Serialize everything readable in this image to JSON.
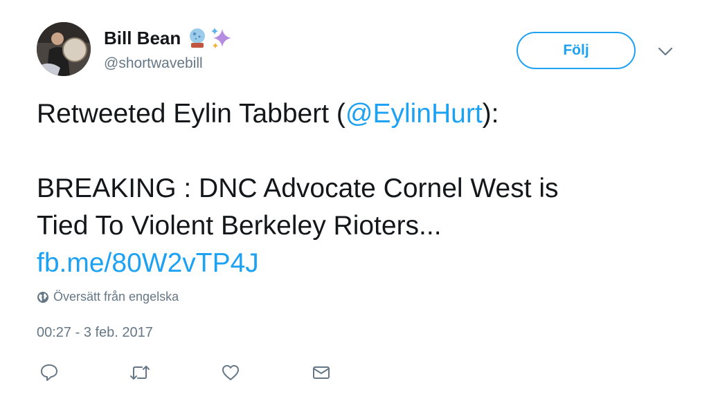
{
  "user": {
    "name": "Bill Bean",
    "handle": "@shortwavebill",
    "name_emojis": [
      "crystal-ball-icon",
      "sparkles-icon"
    ]
  },
  "follow_button": {
    "label": "Följ"
  },
  "tweet": {
    "retweet_prefix": "Retweeted Eylin Tabbert (",
    "retweet_handle": "@EylinHurt",
    "retweet_suffix": "):",
    "body_line1": "BREAKING : DNC Advocate Cornel West is",
    "body_line2": "Tied To Violent Berkeley Rioters...",
    "link": "fb.me/80W2vTP4J"
  },
  "translate": {
    "label": "Översätt från engelska",
    "icon": "globe-icon"
  },
  "timestamp": "00:27 - 3 feb. 2017",
  "actions": [
    "reply-icon",
    "retweet-icon",
    "like-icon",
    "direct-message-icon"
  ],
  "colors": {
    "accent": "#1da1f2",
    "text": "#14171a",
    "muted": "#657786"
  }
}
